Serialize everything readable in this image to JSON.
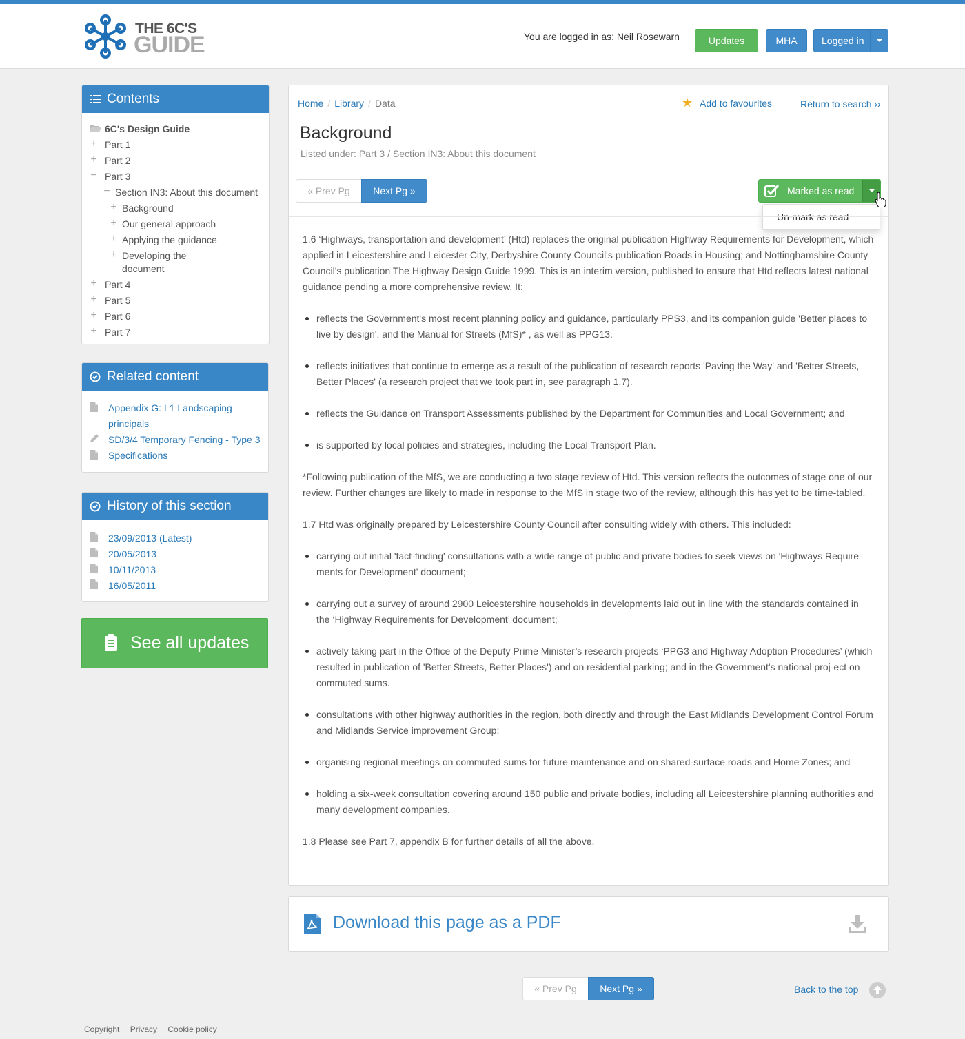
{
  "header": {
    "logo_line1": "THE 6C'S",
    "logo_line2": "GUIDE",
    "logged_in_text": "You are logged in as: Neil Rosewarn",
    "updates_label": "Updates",
    "mha_label": "MHA",
    "logged_in_label": "Logged in"
  },
  "contents": {
    "title": "Contents",
    "root": "6C's Design Guide",
    "part1": "Part 1",
    "part2": "Part 2",
    "part3": "Part 3",
    "section": "Section IN3: About this document",
    "sub1": "Background",
    "sub2": "Our general approach",
    "sub3": "Applying the guidance",
    "sub4a": "Developing the",
    "sub4b": "document",
    "part4": "Part 4",
    "part5": "Part 5",
    "part6": "Part 6",
    "part7": "Part 7"
  },
  "related": {
    "title": "Related content",
    "item1a": "Appendix G: L1 Landscaping",
    "item1b": "principals",
    "item2": "SD/3/4 Temporary Fencing - Type 3",
    "item3": "Specifications"
  },
  "history": {
    "title": "History of this section",
    "items": [
      "23/09/2013 (Latest)",
      "20/05/2013",
      "10/11/2013",
      "16/05/2011"
    ]
  },
  "see_all": "See all updates",
  "main": {
    "crumb_home": "Home",
    "crumb_library": "Library",
    "crumb_data": "Data",
    "add_fav": "Add to favourites",
    "return_search": "Return to search ››",
    "title": "Background",
    "listed_under": "Listed under: Part 3 / Section IN3: About this document",
    "prev": "«  Prev Pg",
    "next": "Next Pg  »",
    "marked_as_read": "Marked as read",
    "unmark": "Un-mark as read",
    "p1": "1.6 ‘Highways, transportation and development’ (Htd) replaces the original publication Highway Requirements for Development, which applied in Leicestershire and Leicester City, Derbyshire County Council's publication Roads in Housing; and Nottinghamshire County Council's publication The Highway Design Guide 1999.  This is an interim version, published to ensure that Htd reflects latest national guidance pending a more comprehensive review. It:",
    "list1": [
      "reflects the Government's most recent planning policy and guidance, particularly PPS3, and its companion guide 'Better places to live by design', and the Manual for Streets (MfS)* , as well as PPG13.",
      "reflects initiatives that continue to emerge as a result of the publication of research reports 'Paving the Way' and 'Better Streets, Better Places' (a research project that we took part in, see paragraph 1.7).",
      "reflects the Guidance on Transport Assessments published by the Department for Communities and Local Government; and",
      "is supported by local policies and strategies, including the Local Transport Plan."
    ],
    "p2": "*Following publication of the MfS, we are conducting a two stage review of Htd. This version reflects the outcomes of stage one of our review. Further changes are likely to made in response to the MfS in stage two of the review, although this has yet to be time-tabled.",
    "p3": "1.7 Htd was originally prepared by Leicestershire County Council after consulting widely with others.  This included:",
    "list2": [
      "carrying out initial 'fact-finding' consultations with a wide range of public and private bodies to seek views on 'Highways Require-ments for Development' document;",
      "carrying out a survey of around 2900 Leicestershire households in developments laid out in line with the standards contained in the ‘Highway Requirements for Development’ document;",
      "actively taking part in the Office of the Deputy Prime Minister’s research projects ‘PPG3 and Highway Adoption Procedures’ (which resulted in publication of 'Better Streets, Better Places') and on residential parking; and in the Government's national proj-ect on commuted sums.",
      "consultations with other highway authorities in the region, both directly and through the East Midlands Development Control Forum and Midlands Service improvement Group;",
      "organising regional meetings on commuted sums for future maintenance and on shared-surface roads and Home Zones; and",
      "holding a six-week consultation covering around 150 public and private bodies, including all Leicestershire planning authorities and many development companies."
    ],
    "p4": "1.8 Please see Part 7, appendix B for further details of all the above."
  },
  "pdf_label": "Download this page as a PDF",
  "back_to_top": "Back to the top",
  "footer": {
    "copyright": "Copyright",
    "privacy": "Privacy",
    "cookie": "Cookie policy"
  },
  "colors": {
    "primary": "#428bca",
    "success": "#5cb85c",
    "star": "#f0ad1c"
  }
}
